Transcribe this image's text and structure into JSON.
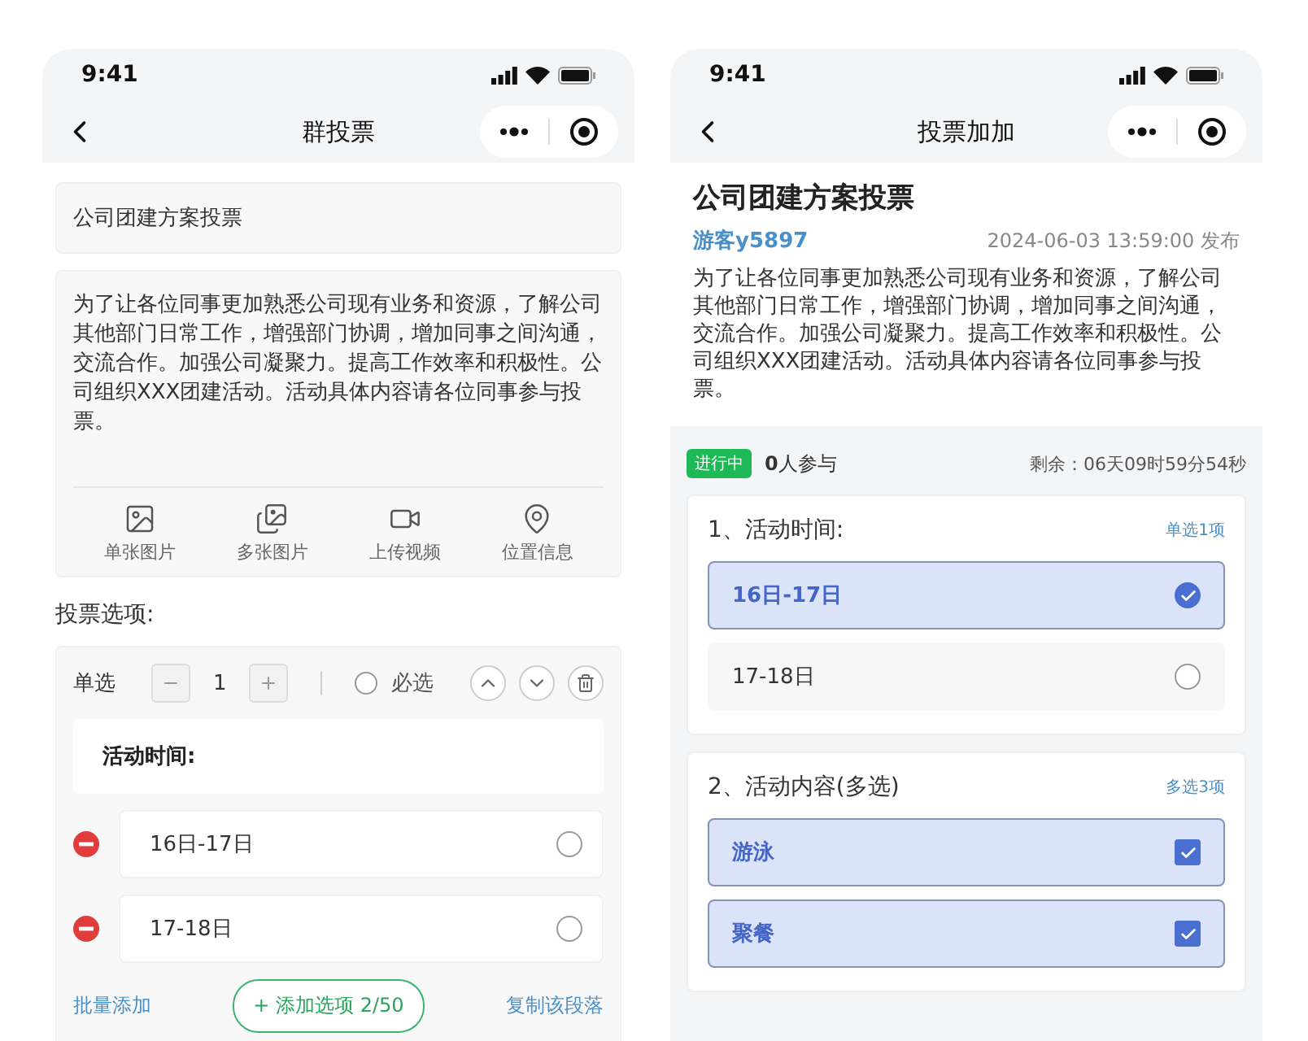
{
  "editor": {
    "status_time": "9:41",
    "title": "群投票",
    "title_field": {
      "value": "公司团建方案投票"
    },
    "description": {
      "value": "为了让各位同事更加熟悉公司现有业务和资源，了解公司其他部门日常工作，增强部门协调，增加同事之间沟通，交流合作。加强公司凝聚力。提高工作效率和积极性。公司组织XXX团建活动。活动具体内容请各位同事参与投票。"
    },
    "attachments": [
      {
        "label": "单张图片",
        "kind": "image"
      },
      {
        "label": "多张图片",
        "kind": "images"
      },
      {
        "label": "上传视频",
        "kind": "video"
      },
      {
        "label": "位置信息",
        "kind": "location"
      }
    ],
    "options_heading": "投票选项:",
    "question": {
      "type_label": "单选",
      "count": "1",
      "required": {
        "label": "必选",
        "checked": false
      },
      "title": "活动时间:",
      "options": [
        {
          "text": "16日-17日",
          "selected": false
        },
        {
          "text": "17-18日",
          "selected": false
        }
      ],
      "batch_add": "批量添加",
      "add_button": "+ 添加选项 2/50",
      "copy": "复制该段落"
    }
  },
  "vote": {
    "status_time": "9:41",
    "title": "投票加加",
    "poll_title": "公司团建方案投票",
    "author": "游客y5897",
    "published": "2024-06-03 13:59:00 发布",
    "description": "为了让各位同事更加熟悉公司现有业务和资源，了解公司其他部门日常工作，增强部门协调，增加同事之间沟通，交流合作。加强公司凝聚力。提高工作效率和积极性。公司组织XXX团建活动。活动具体内容请各位同事参与投票。",
    "status_badge": "进行中",
    "participants": "**0**人参与",
    "remaining": "剩余：06天09时59分54秒",
    "questions": [
      {
        "title": "1、活动时间:",
        "rule": "单选1项",
        "kind": "single",
        "options": [
          {
            "text": "16日-17日",
            "selected": true
          },
          {
            "text": "17-18日",
            "selected": false
          }
        ]
      },
      {
        "title": "2、活动内容(多选)",
        "rule": "多选3项",
        "kind": "multiple",
        "options": [
          {
            "text": "游泳",
            "selected": true
          },
          {
            "text": "聚餐",
            "selected": true
          }
        ]
      }
    ]
  }
}
